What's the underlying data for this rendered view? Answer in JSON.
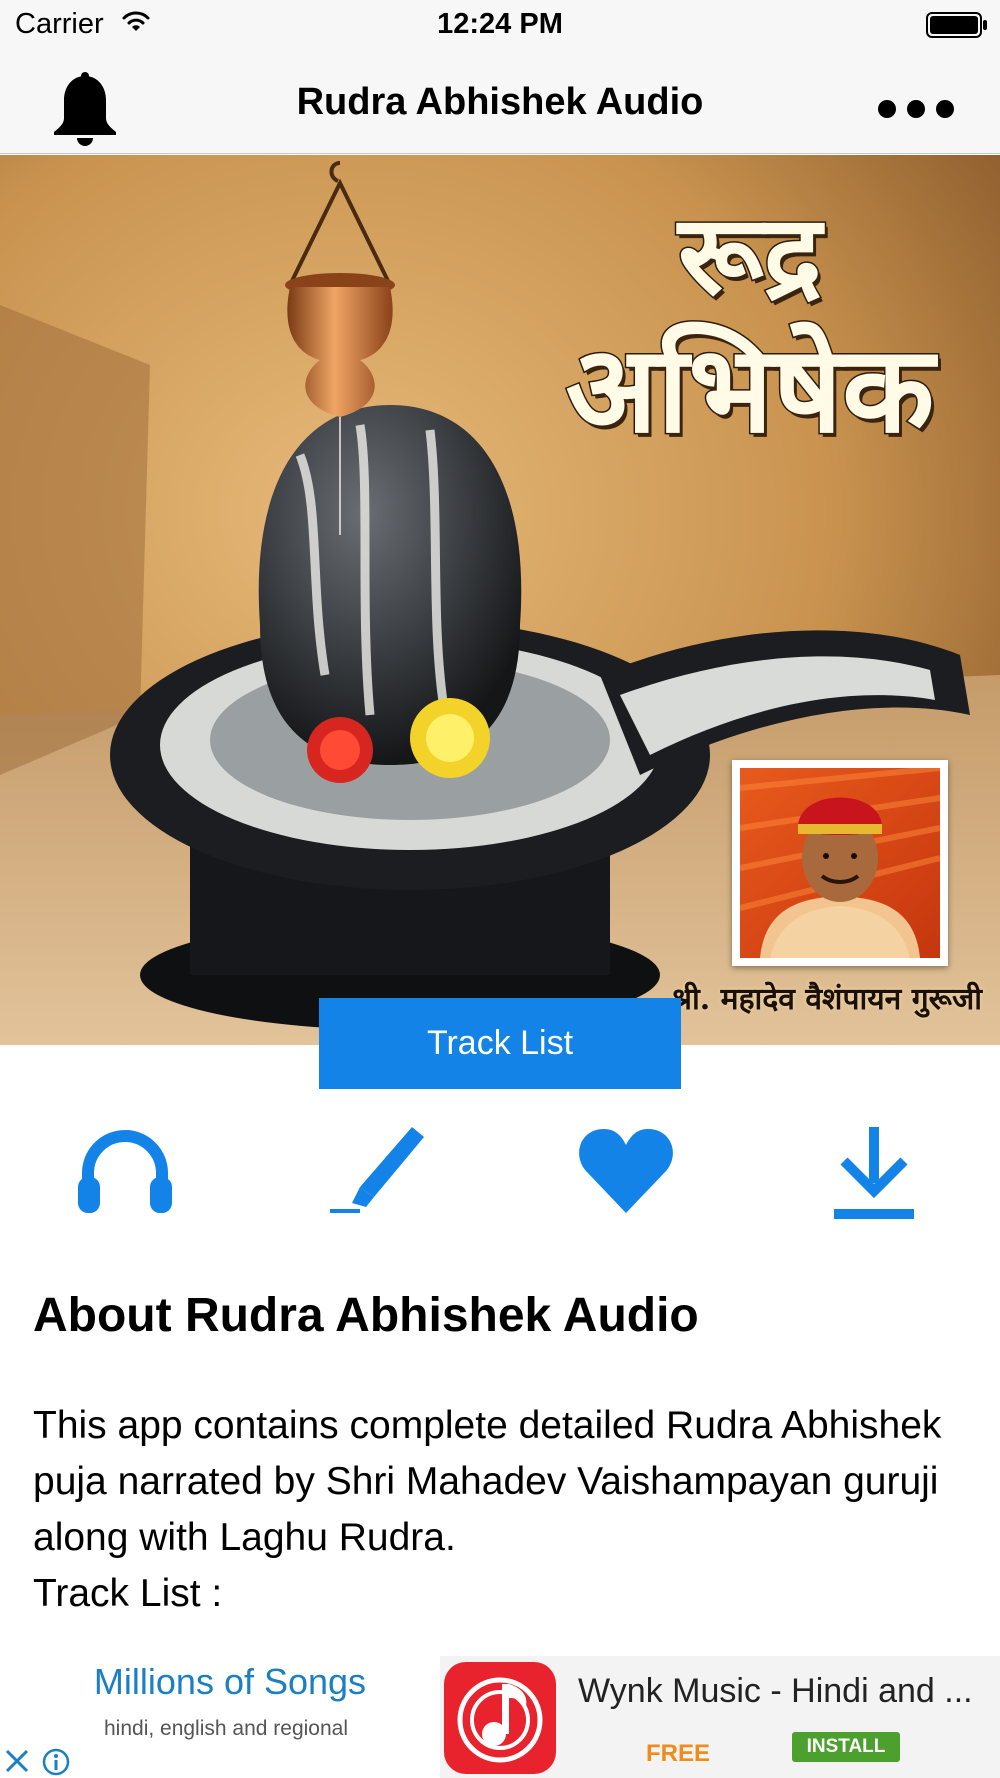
{
  "status_bar": {
    "carrier": "Carrier",
    "time": "12:24 PM",
    "icons": [
      "wifi-icon",
      "battery-icon"
    ]
  },
  "nav_bar": {
    "title": "Rudra Abhishek Audio",
    "left_icon": "bell-icon",
    "right_icon": "more-icon"
  },
  "hero": {
    "title_line1": "रूद्र",
    "title_line2": "अभिषेक",
    "caption": "श्री. महादेव वैशंपायन गुरूजी",
    "image": "shivling-with-kalash"
  },
  "track_list_button": "Track List",
  "actions": [
    {
      "icon": "headphones-icon"
    },
    {
      "icon": "pen-icon"
    },
    {
      "icon": "heart-icon"
    },
    {
      "icon": "download-icon"
    }
  ],
  "about": {
    "title": "About Rudra Abhishek Audio",
    "body": "This app contains complete detailed Rudra Abhishek puja narrated by Shri Mahadev Vaishampayan guruji along with Laghu Rudra.\nTrack List :"
  },
  "ad": {
    "headline": "Millions of Songs",
    "subline": "hindi, english and regional",
    "app_name": "Wynk Music - Hindi and ...",
    "price": "FREE",
    "install_label": "INSTALL"
  },
  "colors": {
    "accent": "#1383e8",
    "bar_background": "#f7f7f7",
    "ad_install": "#4ca02e",
    "ad_price": "#f08c1a",
    "ad_logo": "#e8232e"
  }
}
